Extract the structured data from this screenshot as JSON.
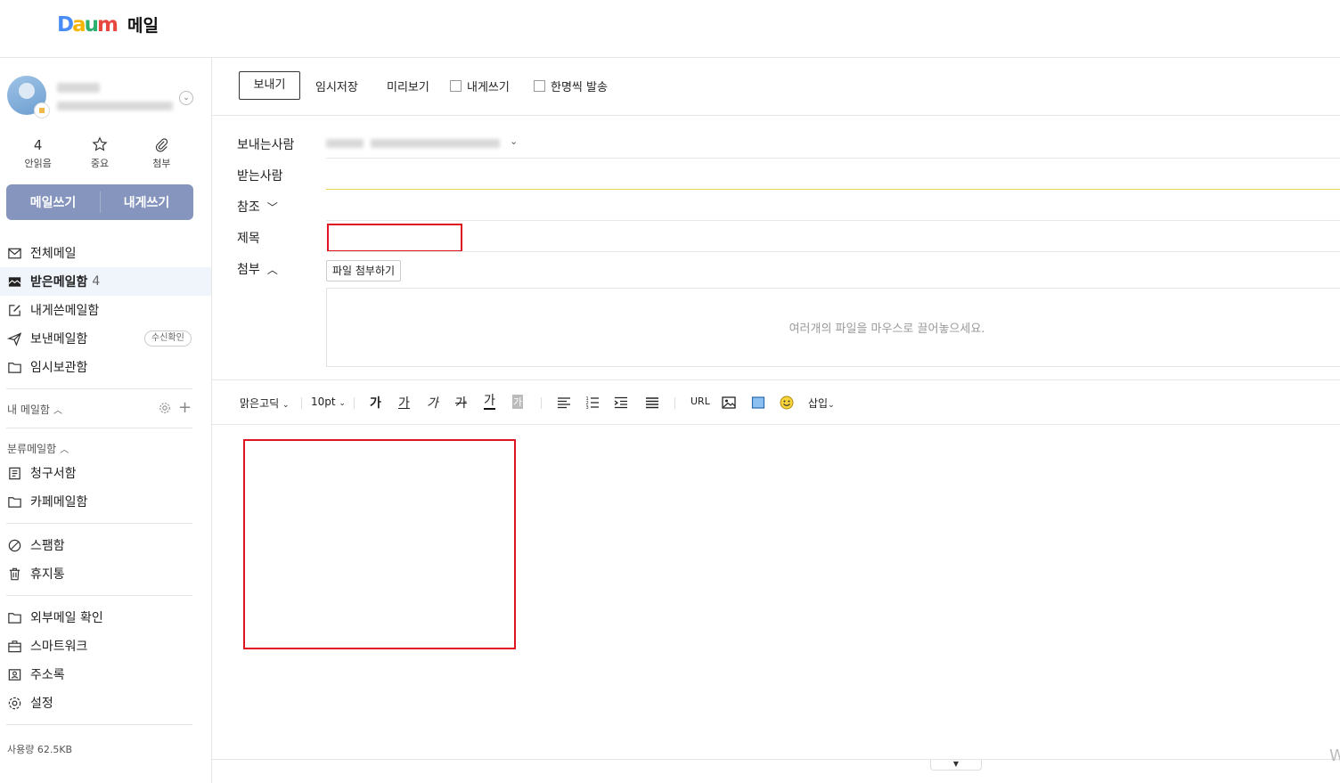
{
  "header": {
    "logo_mark": "Daum",
    "logo_text": "메일"
  },
  "sidebar": {
    "quick": [
      {
        "top": "4",
        "label": "안읽음",
        "icon": "unread-count"
      },
      {
        "top": "",
        "label": "중요",
        "icon": "star-icon"
      },
      {
        "top": "",
        "label": "첨부",
        "icon": "paperclip-icon"
      }
    ],
    "write_label": "메일쓰기",
    "self_write_label": "내게쓰기",
    "nav_main": [
      {
        "label": "전체메일",
        "icon": "mail-icon"
      },
      {
        "label": "받은메일함",
        "count": "4",
        "icon": "inbox-icon",
        "active": true
      },
      {
        "label": "내게쓴메일함",
        "icon": "edit-icon"
      },
      {
        "label": "보낸메일함",
        "icon": "send-icon",
        "badge": "수신확인"
      },
      {
        "label": "임시보관함",
        "icon": "folder-icon"
      }
    ],
    "my_mailbox_title": "내 메일함",
    "category_title": "분류메일함",
    "nav_category": [
      {
        "label": "청구서함",
        "icon": "receipt-icon"
      },
      {
        "label": "카페메일함",
        "icon": "folder-icon"
      }
    ],
    "nav_misc": [
      {
        "label": "스팸함",
        "icon": "ban-icon"
      },
      {
        "label": "휴지통",
        "icon": "trash-icon"
      }
    ],
    "nav_tools": [
      {
        "label": "외부메일 확인",
        "icon": "folder-icon"
      },
      {
        "label": "스마트워크",
        "icon": "briefcase-icon"
      },
      {
        "label": "주소록",
        "icon": "contacts-icon"
      },
      {
        "label": "설정",
        "icon": "gear-icon"
      }
    ],
    "usage": "사용량 62.5KB"
  },
  "toolbar": {
    "send": "보내기",
    "save_draft": "임시저장",
    "preview": "미리보기",
    "to_self": "내게쓰기",
    "individual_send": "한명씩 발송"
  },
  "compose": {
    "from_label": "보내는사람",
    "to_label": "받는사람",
    "cc_label": "참조",
    "subject_label": "제목",
    "attach_label": "첨부",
    "attach_button": "파일 첨부하기",
    "dropzone_text": "여러개의 파일을 마우스로 끌어놓으세요."
  },
  "editor": {
    "font": "맑은고딕",
    "size": "10pt",
    "bold": "가",
    "underline": "가",
    "italic": "가",
    "strike": "가",
    "font_color": "가",
    "bg_color": "가",
    "url": "URL",
    "insert": "삽입"
  },
  "watermark": "W"
}
